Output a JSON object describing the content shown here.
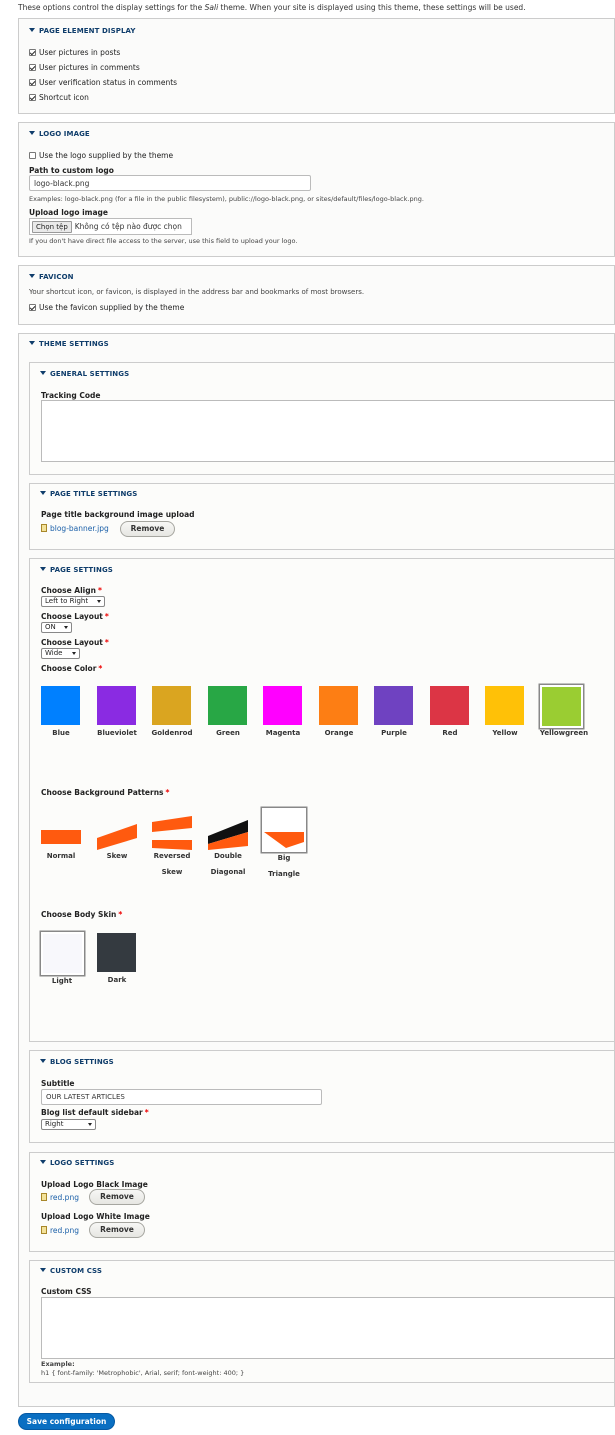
{
  "intro": {
    "before": "These options control the display settings for the ",
    "theme": "Sali",
    "after": " theme. When your site is displayed using this theme, these settings will be used."
  },
  "page_element_display": {
    "legend": "PAGE ELEMENT DISPLAY",
    "items": [
      {
        "label": "User pictures in posts",
        "checked": true
      },
      {
        "label": "User pictures in comments",
        "checked": true
      },
      {
        "label": "User verification status in comments",
        "checked": true
      },
      {
        "label": "Shortcut icon",
        "checked": true
      }
    ]
  },
  "logo_image": {
    "legend": "LOGO IMAGE",
    "use_default": "Use the logo supplied by the theme",
    "path_label": "Path to custom logo",
    "path_value": "logo-black.png",
    "examples": "Examples: logo-black.png (for a file in the public filesystem), public://logo-black.png, or sites/default/files/logo-black.png.",
    "upload_label": "Upload logo image",
    "file_button": "Chọn tệp",
    "file_none": "Không có tệp nào được chọn",
    "upload_help": "If you don't have direct file access to the server, use this field to upload your logo."
  },
  "favicon": {
    "legend": "FAVICON",
    "desc": "Your shortcut icon, or favicon, is displayed in the address bar and bookmarks of most browsers.",
    "use_default": "Use the favicon supplied by the theme"
  },
  "theme_settings": {
    "legend": "THEME SETTINGS",
    "general": {
      "legend": "GENERAL SETTINGS",
      "tracking_label": "Tracking Code"
    },
    "page_title": {
      "legend": "PAGE TITLE SETTINGS",
      "upload_label": "Page title background image upload",
      "file": "blog-banner.jpg",
      "remove": "Remove"
    },
    "page_settings": {
      "legend": "PAGE SETTINGS",
      "align_label": "Choose Align",
      "align_value": "Left to Right",
      "layout1_label": "Choose Layout",
      "layout1_value": "ON",
      "layout2_label": "Choose Layout",
      "layout2_value": "Wide",
      "color_label": "Choose Color",
      "colors": [
        {
          "name": "Blue",
          "hex": "#0080ff"
        },
        {
          "name": "Blueviolet",
          "hex": "#8a2be2"
        },
        {
          "name": "Goldenrod",
          "hex": "#daa520"
        },
        {
          "name": "Green",
          "hex": "#28a745"
        },
        {
          "name": "Magenta",
          "hex": "#ff00ff"
        },
        {
          "name": "Orange",
          "hex": "#fd7e14"
        },
        {
          "name": "Purple",
          "hex": "#6f42c1"
        },
        {
          "name": "Red",
          "hex": "#dc3545"
        },
        {
          "name": "Yellow",
          "hex": "#ffc107"
        },
        {
          "name": "Yellowgreen",
          "hex": "#9acd32"
        }
      ],
      "selected_color": "Yellowgreen",
      "patterns_label": "Choose Background Patterns",
      "patterns": [
        {
          "line1": "Normal",
          "line2": ""
        },
        {
          "line1": "Skew",
          "line2": ""
        },
        {
          "line1": "Reversed",
          "line2": "Skew"
        },
        {
          "line1": "Double",
          "line2": "Diagonal"
        },
        {
          "line1": "Big",
          "line2": "Triangle"
        }
      ],
      "selected_pattern": "Big Triangle",
      "skin_label": "Choose Body Skin",
      "skins": [
        {
          "name": "Light",
          "hex": "#f8f8fc"
        },
        {
          "name": "Dark",
          "hex": "#343a40"
        }
      ],
      "selected_skin": "Light"
    },
    "blog": {
      "legend": "BLOG SETTINGS",
      "subtitle_label": "Subtitle",
      "subtitle_value": "OUR LATEST ARTICLES",
      "sidebar_label": "Blog list default sidebar",
      "sidebar_value": "Right"
    },
    "logo_settings": {
      "legend": "LOGO SETTINGS",
      "black_label": "Upload Logo Black Image",
      "black_file": "red.png",
      "white_label": "Upload Logo White Image",
      "white_file": "red.png",
      "remove": "Remove"
    },
    "custom_css": {
      "legend": "CUSTOM CSS",
      "label": "Custom CSS",
      "example_label": "Example:",
      "example_code": "h1 { font-family: 'Metrophobic', Arial, serif; font-weight: 400; }"
    }
  },
  "save_label": "Save configuration",
  "colors": {
    "accent": "#0a6fc2",
    "legend": "#0f3d6b",
    "link": "#1a5fa8",
    "pattern_orange": "#ff5a0f"
  }
}
